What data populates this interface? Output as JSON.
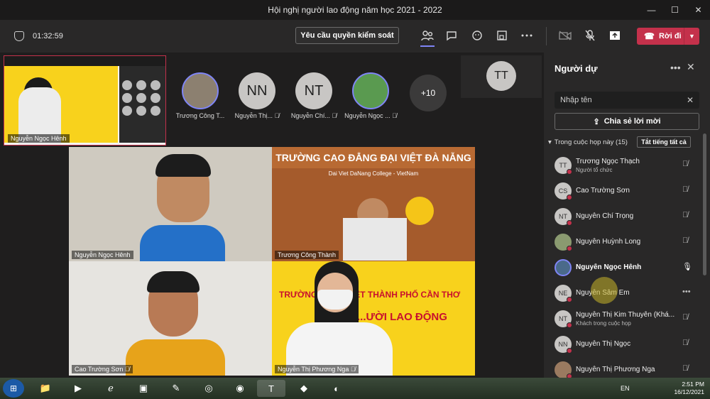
{
  "window": {
    "title": "Hội nghị người lao động năm học 2021 - 2022",
    "minimize": "—",
    "maximize": "☐",
    "close": "✕"
  },
  "toolbar": {
    "timer": "01:32:59",
    "request_control_label": "Yêu cầu quyền kiểm soát",
    "leave_label": "Rời đi",
    "icons": [
      "people-icon",
      "chat-icon",
      "reactions-icon",
      "rooms-icon",
      "more-icon",
      "camera-off-icon",
      "mic-off-icon",
      "share-icon",
      "phone-icon"
    ]
  },
  "mini_share": {
    "presenter": "Nguyễn Ngọc Hênh"
  },
  "avatar_strip": [
    {
      "name": "Trương Công T...",
      "initials": "",
      "ring": true
    },
    {
      "name": "Nguyễn Thị...",
      "initials": "NN",
      "ring": false
    },
    {
      "name": "Nguyễn Chí...",
      "initials": "NT",
      "ring": false
    },
    {
      "name": "Nguyễn Ngọc ...",
      "initials": "",
      "ring": true
    }
  ],
  "more_count": "+10",
  "tt_tile": {
    "initials": "TT"
  },
  "video_tiles": [
    {
      "name": "Nguyễn Ngọc Hênh"
    },
    {
      "name": "Trương Công Thành",
      "school": "TRƯỜNG CAO ĐẲNG ĐẠI VIỆT ĐÀ NẴNG",
      "school_sub": "Dai Viet DaNang College - VietNam"
    },
    {
      "name": "Cao Trường Sơn"
    },
    {
      "name": "Nguyễn Thị Phương Nga",
      "banner": "TRƯỜNG ... ĐẠI VIỆT THÀNH PHỐ CẦN THƠ",
      "banner2": "...ƯỜI LAO ĐỘNG"
    }
  ],
  "panel": {
    "title": "Người dự",
    "search_placeholder": "Nhập tên",
    "share_invite_label": "Chia sẻ lời mời",
    "section_label": "Trong cuộc họp này (15)",
    "mute_all_label": "Tắt tiếng tất cả",
    "participants": [
      {
        "initials": "TT",
        "name": "Trương Ngọc Thạch",
        "role": "Người tổ chức",
        "mic": "muted"
      },
      {
        "initials": "CS",
        "name": "Cao Trường Sơn",
        "role": "",
        "mic": "muted"
      },
      {
        "initials": "NT",
        "name": "Nguyễn Chí Trọng",
        "role": "",
        "mic": "muted"
      },
      {
        "initials": "",
        "name": "Nguyễn Huỳnh Long",
        "role": "",
        "mic": "muted"
      },
      {
        "initials": "",
        "name": "Nguyễn Ngọc Hênh",
        "role": "",
        "mic": "on"
      },
      {
        "initials": "NE",
        "name": "Nguyễn Sâm Em",
        "role": "",
        "mic": "more"
      },
      {
        "initials": "NT",
        "name": "Nguyễn Thị Kim Thuyên (Khá...",
        "role": "Khách trong cuộc họp",
        "mic": "muted"
      },
      {
        "initials": "NN",
        "name": "Nguyễn Thị Ngọc",
        "role": "",
        "mic": "muted"
      },
      {
        "initials": "",
        "name": "Nguyễn Thị Phương Nga",
        "role": "",
        "mic": "muted"
      }
    ]
  },
  "taskbar": {
    "lang": "EN",
    "time": "2:51 PM",
    "date": "16/12/2021",
    "apps": [
      "explorer-icon",
      "media-player-icon",
      "ie-icon",
      "terminal-icon",
      "paint-icon",
      "app-icon",
      "chrome-icon",
      "teams-icon",
      "app2-icon",
      "app3-icon"
    ]
  },
  "colors": {
    "accent": "#7f85f5",
    "leave": "#c4314b",
    "panel": "#292828",
    "banner_yellow": "#f8d21c"
  }
}
